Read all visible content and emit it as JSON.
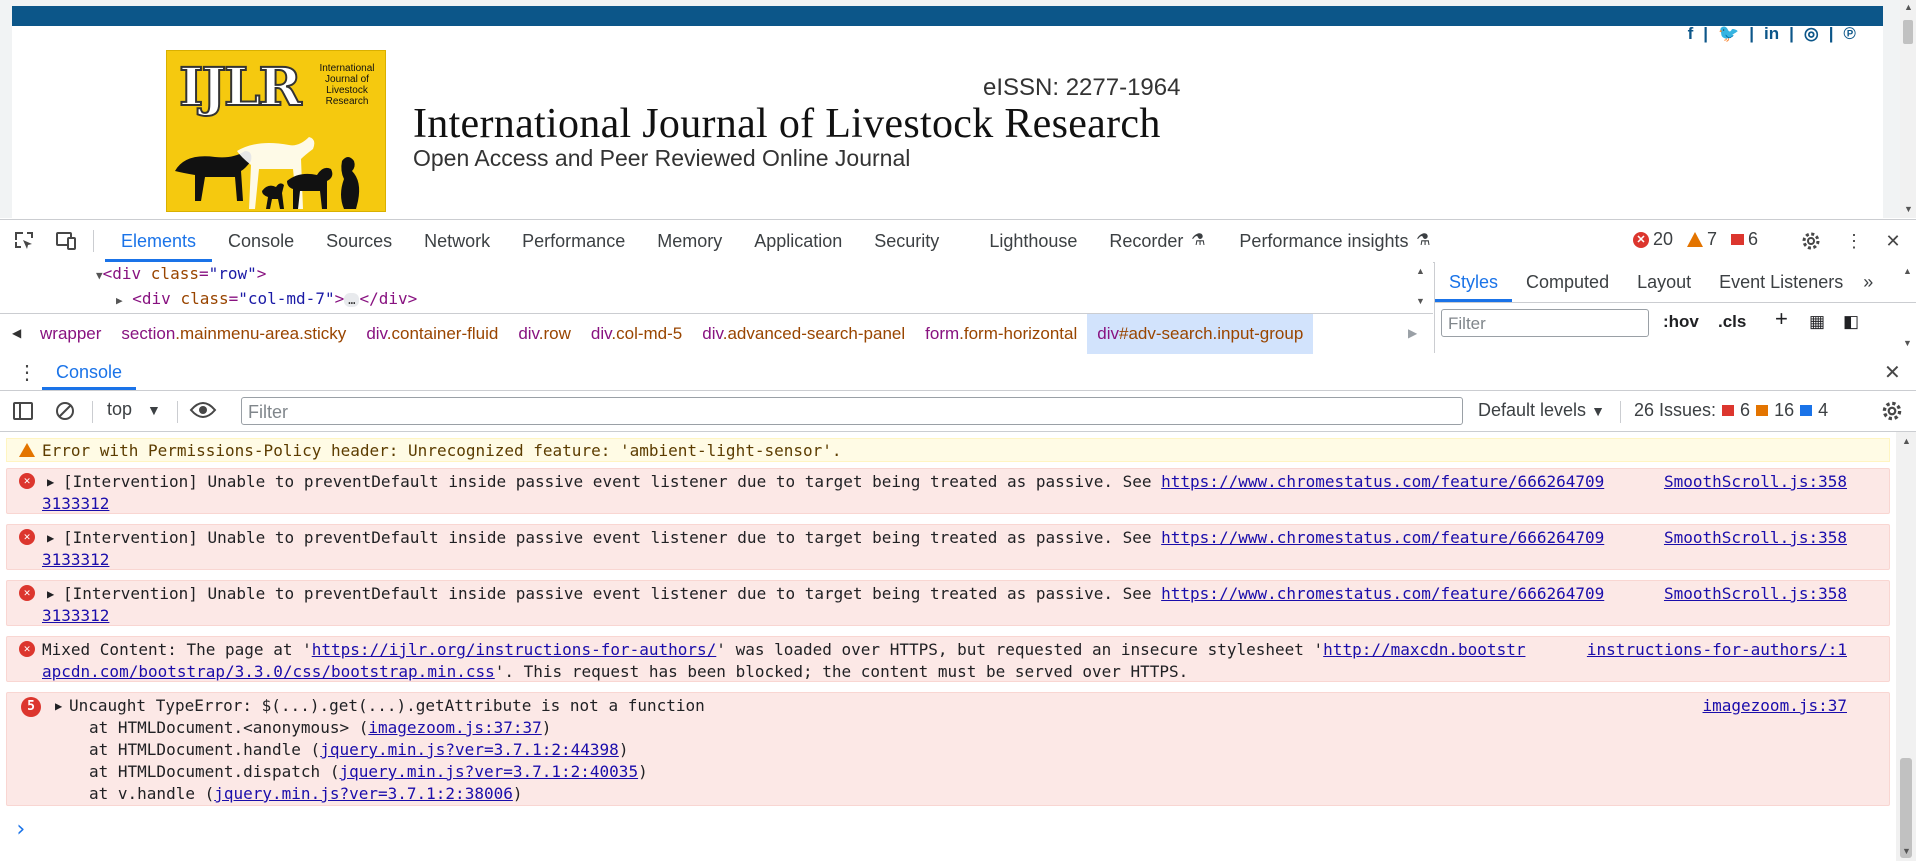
{
  "page": {
    "social_icons": [
      "facebook-icon",
      "twitter-icon",
      "linkedin-icon",
      "instagram-icon",
      "pinterest-icon"
    ],
    "logo_text_main": "IJLR",
    "logo_text_side": "International Journal of Livestock Research",
    "eissn": "eISSN: 2277-1964",
    "journal_title": "International Journal of Livestock Research",
    "journal_subtitle": "Open Access and Peer Reviewed Online Journal",
    "brand_color": "#0c5689",
    "logo_color": "#f5c90f"
  },
  "devtools": {
    "tabs": [
      "Elements",
      "Console",
      "Sources",
      "Network",
      "Performance",
      "Memory",
      "Application",
      "Security",
      "Lighthouse",
      "Recorder",
      "Performance insights"
    ],
    "active_tab": "Elements",
    "errors": "20",
    "warnings": "7",
    "issues": "6"
  },
  "elements": {
    "line1_tag_open": "<div",
    "line1_attr": "class",
    "line1_val": "\"row\"",
    "line1_tag_close": ">",
    "line2_tag_open": "<div",
    "line2_attr": "class",
    "line2_val": "\"col-md-7\"",
    "line2_tag_close": ">",
    "line2_ellipsis": "…",
    "line2_end": "</div>"
  },
  "breadcrumbs": [
    {
      "tag": "wrapper",
      "cls": ""
    },
    {
      "tag": "section",
      "cls": ".mainmenu-area.sticky"
    },
    {
      "tag": "div",
      "cls": ".container-fluid"
    },
    {
      "tag": "div",
      "cls": ".row"
    },
    {
      "tag": "div",
      "cls": ".col-md-5"
    },
    {
      "tag": "div",
      "cls": ".advanced-search-panel"
    },
    {
      "tag": "form",
      "cls": ".form-horizontal"
    },
    {
      "tag": "div",
      "cls": "#adv-search.input-group"
    }
  ],
  "styles": {
    "tabs": [
      "Styles",
      "Computed",
      "Layout",
      "Event Listeners"
    ],
    "filter_placeholder": "Filter",
    "hov": ":hov",
    "cls": ".cls"
  },
  "console": {
    "drawer_tab": "Console",
    "context": "top",
    "filter_placeholder": "Filter",
    "levels": "Default levels",
    "issues_label": "26 Issues:",
    "issues_err": "6",
    "issues_warn": "16",
    "issues_info": "4",
    "messages": {
      "warn1": "Error with Permissions-Policy header: Unrecognized feature: 'ambient-light-sensor'.",
      "intervention_text": "[Intervention] Unable to preventDefault inside passive event listener due to target being treated as passive. See ",
      "intervention_link1": "https://www.chromestatus.com/feature/666264709",
      "intervention_link2": "3133312",
      "intervention_src": "SmoothScroll.js:358",
      "mixed_a": "Mixed Content: The page at '",
      "mixed_link1": "https://ijlr.org/instructions-for-authors/",
      "mixed_b": "' was loaded over HTTPS, but requested an insecure stylesheet '",
      "mixed_link2a": "http://maxcdn.bootstr",
      "mixed_link2b": "apcdn.com/bootstrap/3.3.0/css/bootstrap.min.css",
      "mixed_c": "'. This request has been blocked; the content must be served over HTTPS.",
      "mixed_src": "instructions-for-authors/:1",
      "type_count": "5",
      "type_error": "Uncaught TypeError: $(...).get(...).getAttribute is not a function",
      "type_src": "imagezoom.js:37",
      "stack1_a": "at HTMLDocument.<anonymous> (",
      "stack1_link": "imagezoom.js:37:37",
      "stack2_a": "at HTMLDocument.handle (",
      "stack2_link": "jquery.min.js?ver=3.7.1:2:44398",
      "stack3_a": "at HTMLDocument.dispatch (",
      "stack3_link": "jquery.min.js?ver=3.7.1:2:40035",
      "stack4_a": "at v.handle (",
      "stack4_link": "jquery.min.js?ver=3.7.1:2:38006",
      "close_paren": ")"
    },
    "prompt": "›"
  }
}
